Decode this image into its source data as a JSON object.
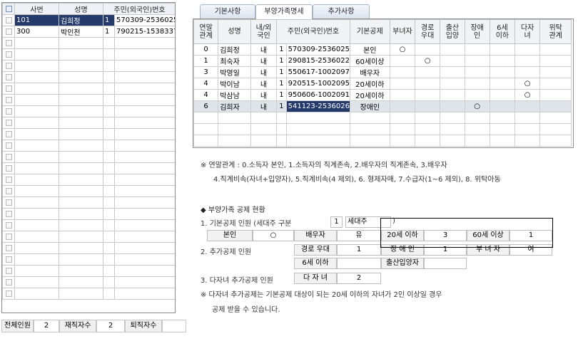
{
  "left_grid": {
    "columns": [
      "사번",
      "성명",
      "주민(외국인)번호"
    ],
    "rows": [
      {
        "id": "101",
        "name": "김희정",
        "type": "1",
        "rrn": "570309-2536025",
        "selected": true
      },
      {
        "id": "300",
        "name": "박인천",
        "type": "1",
        "rrn": "790215-1538337",
        "selected": false
      }
    ],
    "empty_rows": 23
  },
  "summary": {
    "total_label": "전체인원",
    "total_value": "2",
    "active_label": "재직자수",
    "active_value": "2",
    "retired_label": "퇴직자수",
    "retired_value": ""
  },
  "tabs": [
    "기본사항",
    "부양가족명세",
    "추가사항"
  ],
  "active_tab": 1,
  "dependents": {
    "columns": [
      "연말\n관계",
      "성명",
      "내/외\n국인",
      "주민(외국인)번호",
      "기본공제",
      "부녀자",
      "경로\n우대",
      "출산\n입양",
      "장애\n인",
      "6세\n이하",
      "다자\n녀",
      "위탁\n관계"
    ],
    "rows": [
      {
        "rel": "0",
        "name": "김희정",
        "nat": "내",
        "type": "1",
        "rrn": "570309-2536025",
        "basic": "본인",
        "marks": {
          "5": "○"
        }
      },
      {
        "rel": "1",
        "name": "최숙자",
        "nat": "내",
        "type": "1",
        "rrn": "290815-2536022",
        "basic": "60세이상",
        "marks": {
          "6": "○"
        }
      },
      {
        "rel": "3",
        "name": "박영일",
        "nat": "내",
        "type": "1",
        "rrn": "550617-1002097",
        "basic": "배우자",
        "marks": {}
      },
      {
        "rel": "4",
        "name": "박이남",
        "nat": "내",
        "type": "1",
        "rrn": "920515-1002095",
        "basic": "20세이하",
        "marks": {
          "10": "○"
        }
      },
      {
        "rel": "4",
        "name": "박삼남",
        "nat": "내",
        "type": "1",
        "rrn": "950606-1002091",
        "basic": "20세이하",
        "marks": {
          "10": "○"
        }
      },
      {
        "rel": "6",
        "name": "김희자",
        "nat": "내",
        "type": "1",
        "rrn": "541123-2536026",
        "basic": "장애인",
        "marks": {
          "8": "○"
        },
        "selected": true
      }
    ],
    "empty_rows": 3
  },
  "notes": {
    "relation_line1": "※ 연말관계 : 0.소득자 본인, 1.소득자의 직계존속, 2.배우자의 직계존속, 3.배우자",
    "relation_line2": "4.직계비속(자녀+입양자), 5.직계비속(4 제외), 6. 형제자매, 7.수급자(1~6 제외), 8. 위탁아동"
  },
  "status": {
    "heading": "◆ 부양가족 공제 현황",
    "basic_label": "1. 기본공제 인원  (세대주 구분",
    "household_code": "1",
    "household_name": "세대주",
    "paren_close": ")",
    "basic_row": [
      {
        "label": "본인",
        "value": "○"
      },
      {
        "label": "배우자",
        "value": "유"
      },
      {
        "label": "20세 이하",
        "value": "3"
      },
      {
        "label": "60세 이상",
        "value": "1"
      }
    ],
    "additional_label": "2. 추가공제 인원",
    "additional_row1": [
      {
        "label": "경로 우대",
        "value": "1"
      },
      {
        "label": "장 애 인",
        "value": "1"
      },
      {
        "label": "부 녀 자",
        "value": "여"
      }
    ],
    "additional_row2": [
      {
        "label": "6세 이하",
        "value": ""
      },
      {
        "label": "출산입양자",
        "value": ""
      }
    ],
    "multi_label": "3. 다자녀 추가공제 인원",
    "multi_box_label": "다 자 녀",
    "multi_value": "2",
    "footnote1": "※ 다자녀 추가공제는 기본공제 대상이 되는 20세 이하의 자녀가 2인 이상일 경우",
    "footnote2": "공제 받을 수 있습니다."
  }
}
